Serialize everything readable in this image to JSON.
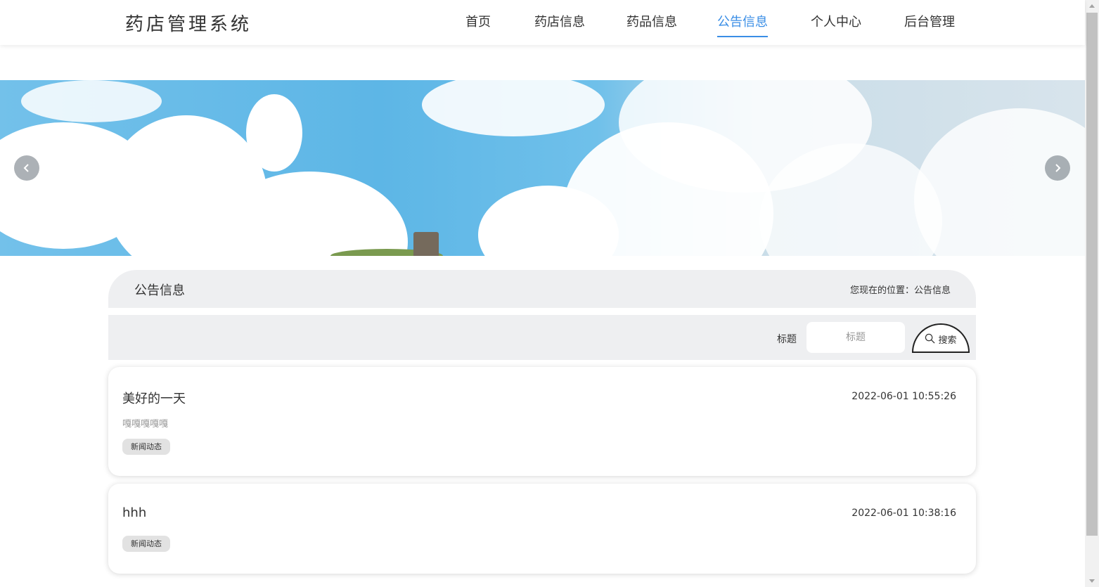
{
  "header": {
    "logo": "药店管理系统",
    "nav": [
      {
        "label": "首页",
        "active": false
      },
      {
        "label": "药店信息",
        "active": false
      },
      {
        "label": "药品信息",
        "active": false
      },
      {
        "label": "公告信息",
        "active": true
      },
      {
        "label": "个人中心",
        "active": false
      },
      {
        "label": "后台管理",
        "active": false
      }
    ]
  },
  "banner": {
    "prev_icon": "chevron-left-icon",
    "next_icon": "chevron-right-icon"
  },
  "section": {
    "title": "公告信息",
    "breadcrumb": "您现在的位置：公告信息"
  },
  "search": {
    "label": "标题",
    "placeholder": "标题",
    "value": "",
    "button_label": "搜索",
    "button_icon": "search-icon"
  },
  "announcements": [
    {
      "title": "美好的一天",
      "time": "2022-06-01 10:55:26",
      "summary": "嘎嘎嘎嘎嘎",
      "tag": "新闻动态"
    },
    {
      "title": "hhh",
      "time": "2022-06-01 10:38:16",
      "summary": "",
      "tag": "新闻动态"
    }
  ],
  "colors": {
    "accent": "#3a8ee6",
    "panel": "#eeeff1",
    "tag": "#e2e2e2"
  }
}
